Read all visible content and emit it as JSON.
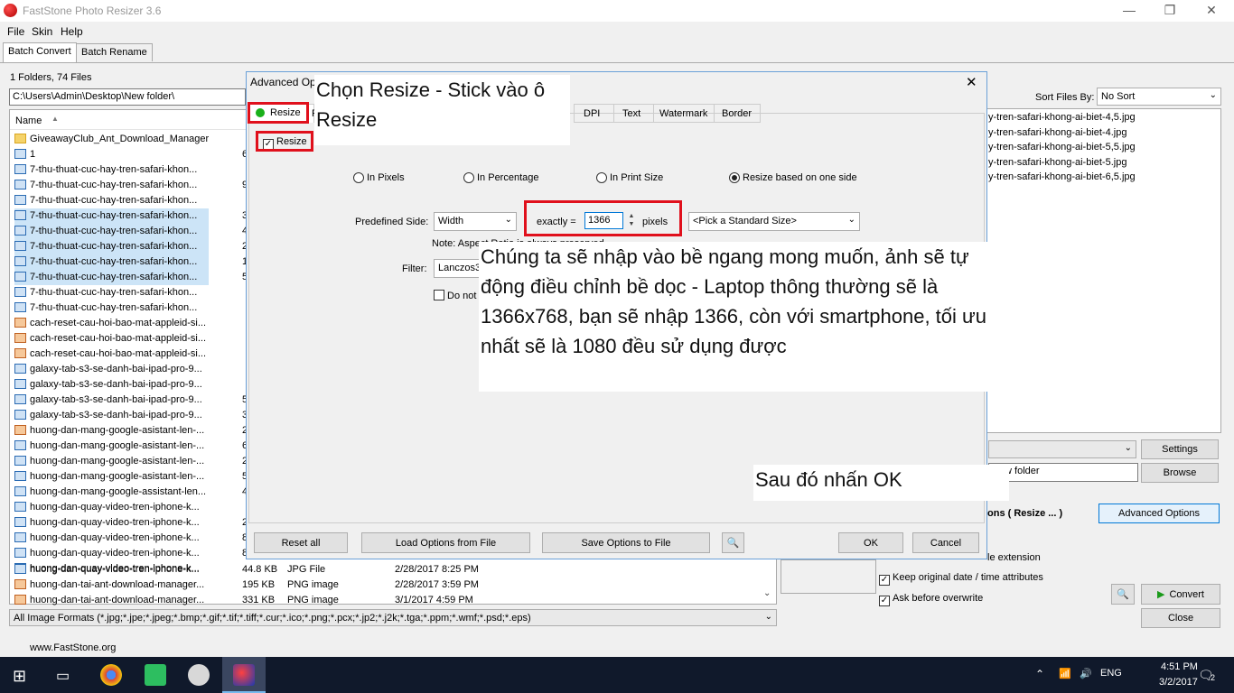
{
  "window": {
    "title": "FastStone Photo Resizer 3.6",
    "minimize": "—",
    "maximize": "❐",
    "close": "✕"
  },
  "menu": [
    "File",
    "Skin",
    "Help"
  ],
  "tabs": {
    "batch_convert": "Batch Convert",
    "batch_rename": "Batch Rename"
  },
  "files": {
    "count": "1 Folders, 74 Files",
    "path": "C:\\Users\\Admin\\Desktop\\New folder\\",
    "header_name": "Name",
    "rows": [
      {
        "name": "GiveawayClub_Ant_Download_Manager",
        "type": "folder",
        "extra": ""
      },
      {
        "name": "1",
        "type": "jpg",
        "extra": "6"
      },
      {
        "name": "7-thu-thuat-cuc-hay-tren-safari-khon...",
        "type": "jpg",
        "extra": ""
      },
      {
        "name": "7-thu-thuat-cuc-hay-tren-safari-khon...",
        "type": "jpg",
        "extra": "9"
      },
      {
        "name": "7-thu-thuat-cuc-hay-tren-safari-khon...",
        "type": "jpg",
        "extra": ""
      },
      {
        "name": "7-thu-thuat-cuc-hay-tren-safari-khon...",
        "type": "jpg",
        "extra": "3",
        "sel": true
      },
      {
        "name": "7-thu-thuat-cuc-hay-tren-safari-khon...",
        "type": "jpg",
        "extra": "4",
        "sel": true
      },
      {
        "name": "7-thu-thuat-cuc-hay-tren-safari-khon...",
        "type": "jpg",
        "extra": "2",
        "sel": true
      },
      {
        "name": "7-thu-thuat-cuc-hay-tren-safari-khon...",
        "type": "jpg",
        "extra": "1",
        "sel": true
      },
      {
        "name": "7-thu-thuat-cuc-hay-tren-safari-khon...",
        "type": "jpg",
        "extra": "5",
        "sel": true
      },
      {
        "name": "7-thu-thuat-cuc-hay-tren-safari-khon...",
        "type": "jpg",
        "extra": ""
      },
      {
        "name": "7-thu-thuat-cuc-hay-tren-safari-khon...",
        "type": "jpg",
        "extra": ""
      },
      {
        "name": "cach-reset-cau-hoi-bao-mat-appleid-si...",
        "type": "png",
        "extra": ""
      },
      {
        "name": "cach-reset-cau-hoi-bao-mat-appleid-si...",
        "type": "png",
        "extra": ""
      },
      {
        "name": "cach-reset-cau-hoi-bao-mat-appleid-si...",
        "type": "png",
        "extra": ""
      },
      {
        "name": "galaxy-tab-s3-se-danh-bai-ipad-pro-9...",
        "type": "jpg",
        "extra": ""
      },
      {
        "name": "galaxy-tab-s3-se-danh-bai-ipad-pro-9...",
        "type": "jpg",
        "extra": ""
      },
      {
        "name": "galaxy-tab-s3-se-danh-bai-ipad-pro-9...",
        "type": "jpg",
        "extra": "5"
      },
      {
        "name": "galaxy-tab-s3-se-danh-bai-ipad-pro-9...",
        "type": "jpg",
        "extra": "3"
      },
      {
        "name": "huong-dan-mang-google-asistant-len-...",
        "type": "png",
        "extra": "2"
      },
      {
        "name": "huong-dan-mang-google-asistant-len-...",
        "type": "jpg",
        "extra": "6"
      },
      {
        "name": "huong-dan-mang-google-asistant-len-...",
        "type": "jpg",
        "extra": "2"
      },
      {
        "name": "huong-dan-mang-google-asistant-len-...",
        "type": "jpg",
        "extra": "5"
      },
      {
        "name": "huong-dan-mang-google-assistant-len...",
        "type": "jpg",
        "extra": "4"
      },
      {
        "name": "huong-dan-quay-video-tren-iphone-k...",
        "type": "jpg",
        "extra": ""
      },
      {
        "name": "huong-dan-quay-video-tren-iphone-k...",
        "type": "jpg",
        "extra": "2"
      },
      {
        "name": "huong-dan-quay-video-tren-iphone-k...",
        "type": "jpg",
        "extra": "8"
      },
      {
        "name": "huong-dan-quay-video-tren-iphone-k...",
        "type": "jpg",
        "extra": "8"
      },
      {
        "name": "huong-dan-quay-video-tren-iphone-k...",
        "type": "jpg",
        "extra": ""
      }
    ],
    "detail_rows": [
      {
        "name": "huong-dan-quay-video-tren-iphone-k...",
        "size": "44.8 KB",
        "ftype": "JPG File",
        "date": "2/28/2017 8:25 PM",
        "type": "jpg"
      },
      {
        "name": "huong-dan-tai-ant-download-manager...",
        "size": "195 KB",
        "ftype": "PNG image",
        "date": "2/28/2017 3:59 PM",
        "type": "png"
      },
      {
        "name": "huong-dan-tai-ant-download-manager...",
        "size": "331 KB",
        "ftype": "PNG image",
        "date": "3/1/2017 4:59 PM",
        "type": "png"
      }
    ],
    "filter": "All Image Formats (*.jpg;*.jpe;*.jpeg;*.bmp;*.gif;*.tif;*.tiff;*.cur;*.ico;*.png;*.pcx;*.jp2;*.j2k;*.tga;*.ppm;*.wmf;*.psd;*.eps)"
  },
  "right": {
    "sort_label": "Sort Files By:",
    "sort_value": "No Sort",
    "files": [
      "y-tren-safari-khong-ai-biet-4,5.jpg",
      "y-tren-safari-khong-ai-biet-4.jpg",
      "y-tren-safari-khong-ai-biet-5,5.jpg",
      "y-tren-safari-khong-ai-biet-5.jpg",
      "y-tren-safari-khong-ai-biet-6,5.jpg"
    ],
    "settings": "Settings",
    "output_folder": "New folder",
    "browse": "Browse",
    "options_label": "ons ( Resize ... )",
    "advanced_options": "Advanced Options",
    "ext_label": "le extension",
    "keep_date": "Keep original date / time attributes",
    "ask_overwrite": "Ask before overwrite",
    "convert": "Convert",
    "close": "Close"
  },
  "status": {
    "website": "www.FastStone.org"
  },
  "dialog": {
    "title": "Advanced Opt",
    "close": "✕",
    "tabs": {
      "resize": "Resize",
      "r": "R",
      "dpi": "DPI",
      "text": "Text",
      "watermark": "Watermark",
      "border": "Border"
    },
    "resize_check": "Resize",
    "radios": {
      "pixels": "In Pixels",
      "percentage": "In Percentage",
      "print": "In Print Size",
      "one_side": "Resize based on one side"
    },
    "predefined_label": "Predefined Side:",
    "side_value": "Width",
    "exactly_label": "exactly =",
    "size_value": "1366",
    "pixels_label": "pixels",
    "standard_size": "<Pick a Standard Size>",
    "note": "Note: Aspect Ratio is always preserved",
    "filter_label": "Filter:",
    "filter_value": "Lanczos3 (",
    "do_not": "Do not",
    "buttons": {
      "reset": "Reset all",
      "load": "Load Options from File",
      "save": "Save Options to File",
      "ok": "OK",
      "cancel": "Cancel"
    }
  },
  "annotations": {
    "a1": "Chọn Resize - Stick vào ô Resize",
    "a2": "Chúng ta sẽ nhập vào bề ngang mong muốn, ảnh sẽ tự động điều chỉnh bề dọc - Laptop thông thường sẽ là 1366x768, bạn sẽ nhập 1366, còn với smartphone, tối ưu nhất sẽ là 1080 đều sử dụng được",
    "a3": "Sau đó nhấn OK"
  },
  "taskbar": {
    "lang": "ENG",
    "time": "4:51 PM",
    "date": "3/2/2017",
    "notif": "2"
  }
}
